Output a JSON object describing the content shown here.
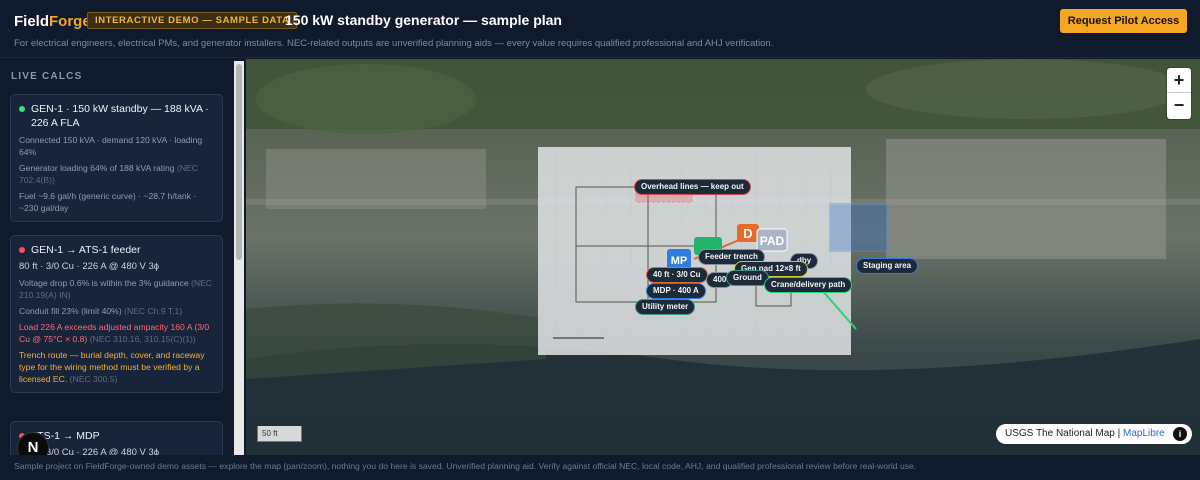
{
  "header": {
    "brand_a": "Field",
    "brand_b": "Forge",
    "demo_badge": "INTERACTIVE DEMO — SAMPLE DATA",
    "plan_title": "150 kW standby generator — sample plan",
    "subtitle": "For electrical engineers, electrical PMs, and generator installers. NEC-related outputs are unverified planning aids — every value requires qualified professional and AHJ verification.",
    "cta": "Request Pilot Access"
  },
  "sidebar": {
    "title": "LIVE CALCS",
    "cards": [
      {
        "status": "ok",
        "head": "GEN-1 · 150 kW standby — 188 kVA · 226 A FLA",
        "lines": [
          {
            "text": "Connected 150 kVA · demand 120 kVA · loading 64%",
            "ref": ""
          },
          {
            "text": "Generator loading 64% of 188 kVA rating",
            "ref": "(NEC 702.4(B))"
          },
          {
            "text": "Fuel ~9.6 gal/h (generic curve) · ~28.7 h/tank · ~230 gal/day",
            "ref": ""
          }
        ]
      },
      {
        "status": "error",
        "head": "GEN-1 → ATS-1 feeder",
        "sub": "80 ft · 3/0 Cu · 226 A @ 480 V 3ϕ",
        "lines": [
          {
            "text": "Voltage drop 0.6% is within the 3% guidance",
            "ref": "(NEC 210.19(A) IN)"
          },
          {
            "text": "Conduit fill 23% (limit 40%)",
            "ref": "(NEC Ch.9 T.1)"
          },
          {
            "text": "Load 226 A exceeds adjusted ampacity 160 A (3/0 Cu @ 75°C × 0.8)",
            "ref": "(NEC 310.16, 310.15(C)(1))"
          },
          {
            "text": "Trench route — burial depth, cover, and raceway type for the wiring method must be verified by a licensed EC.",
            "ref": "(NEC 300.5)"
          }
        ]
      },
      {
        "status": "error",
        "head": "ATS-1 → MDP",
        "sub": "80 ft · 3/0 Cu · 226 A @ 480 V 3ϕ"
      }
    ]
  },
  "map": {
    "zoom_in": "+",
    "zoom_out": "−",
    "scale": "50 ft",
    "attribution": "USGS The National Map",
    "attribution_sep": " | ",
    "attribution_lib": "MapLibre",
    "info": "i",
    "markers": {
      "mp": "MP",
      "d": "D",
      "pad": "PAD"
    },
    "labels": {
      "overhead": "Overhead lines — keep out",
      "feeder": "Feeder trench",
      "genpad": "Gen pad 12×8 ft",
      "standby": "dby",
      "staging": "Staging area",
      "cable": "40 ft · 3/0 Cu",
      "n400": "400",
      "ground": "Ground",
      "crane": "Crane/delivery path",
      "mdp": "MDP · 400 A",
      "meter": "Utility meter"
    }
  },
  "fab": "N",
  "footer": "Sample project on FieldForge-owned demo assets — explore the map (pan/zoom), nothing you do here is saved. Unverified planning aid. Verify against official NEC, local code, AHJ, and qualified professional review before real-world use."
}
